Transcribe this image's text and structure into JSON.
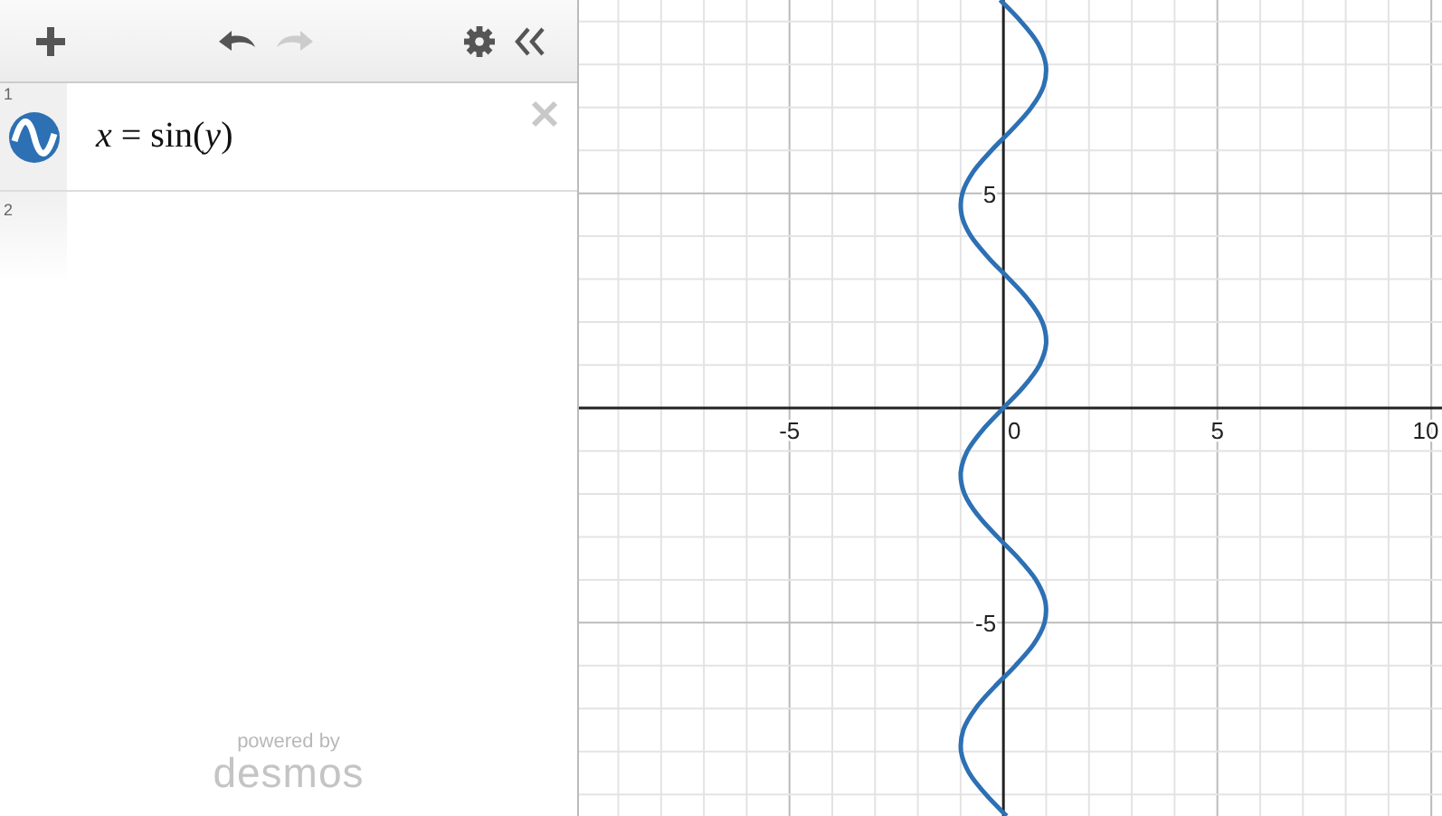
{
  "toolbar": {
    "buttons": [
      {
        "kind": "add",
        "disabled": false
      },
      {
        "kind": "undo",
        "disabled": false
      },
      {
        "kind": "redo",
        "disabled": true
      },
      {
        "kind": "settings",
        "disabled": false
      },
      {
        "kind": "collapse",
        "disabled": false
      }
    ]
  },
  "expressions": [
    {
      "index": "1",
      "latex": "*x* = sin(*y*)",
      "color": "#2d70b3"
    },
    {
      "index": "2"
    }
  ],
  "branding": {
    "tagline": "powered by",
    "name": "desmos"
  },
  "graph": {
    "chart_data": {
      "type": "line",
      "xlim": [
        -9.92,
        10.25
      ],
      "ylim": [
        -9.5,
        9.5
      ],
      "grid": true,
      "xticks": [
        -5,
        0,
        5,
        10
      ],
      "yticks": [
        -5,
        5
      ],
      "x": [
        0.075,
        -0.412,
        -0.798,
        -0.989,
        -0.938,
        -0.657,
        -0.215,
        0.279,
        0.706,
        0.959,
        0.978,
        0.757,
        0.351,
        -0.141,
        -0.598,
        -0.909,
        -0.997,
        -0.841,
        -0.479,
        0,
        0.479,
        0.841,
        0.997,
        0.909,
        0.598,
        0.141,
        -0.351,
        -0.757,
        -0.978,
        -0.959,
        -0.706,
        -0.279,
        0.215,
        0.657,
        0.938,
        0.989,
        0.798,
        0.412,
        -0.075
      ],
      "series": [
        {
          "color": "#2d70b3",
          "values": [
            -9.5,
            -9,
            -8.5,
            -8,
            -7.5,
            -7,
            -6.5,
            -6,
            -5.5,
            -5,
            -4.5,
            -4,
            -3.5,
            -3,
            -2.5,
            -2,
            -1.5,
            -1,
            -0.5,
            0,
            0.5,
            1,
            1.5,
            2,
            2.5,
            3,
            3.5,
            4,
            4.5,
            5,
            5.5,
            6,
            6.5,
            7,
            7.5,
            8,
            8.5,
            9,
            9.5
          ]
        }
      ]
    }
  }
}
